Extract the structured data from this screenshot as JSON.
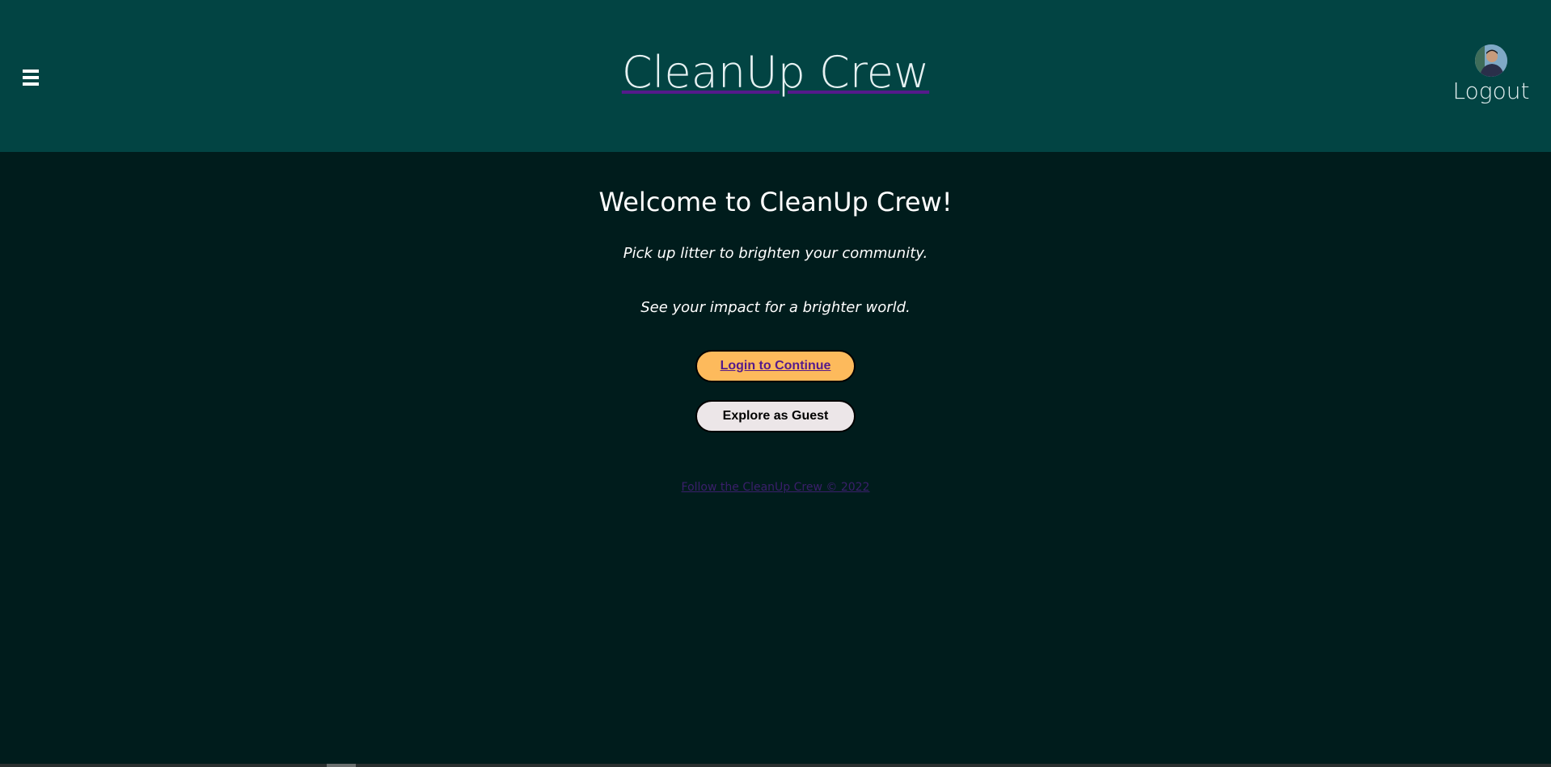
{
  "header": {
    "menu_icon": "hamburger-menu-icon",
    "title": "CleanUp Crew",
    "account": {
      "avatar_icon": "user-avatar",
      "logout_label": "Logout"
    }
  },
  "main": {
    "heading": "Welcome to CleanUp Crew!",
    "tagline_1": "Pick up litter to brighten your community.",
    "tagline_2": "See your impact for a brighter world.",
    "login_button": "Login to Continue",
    "guest_button": "Explore as Guest",
    "footer_link": "Follow the CleanUp Crew © 2022"
  },
  "colors": {
    "header_bg": "#024443",
    "page_bg": "#001c1c",
    "login_button_bg": "#fdba5c",
    "guest_button_bg": "#ece6e8",
    "link_color": "#551a8b"
  }
}
